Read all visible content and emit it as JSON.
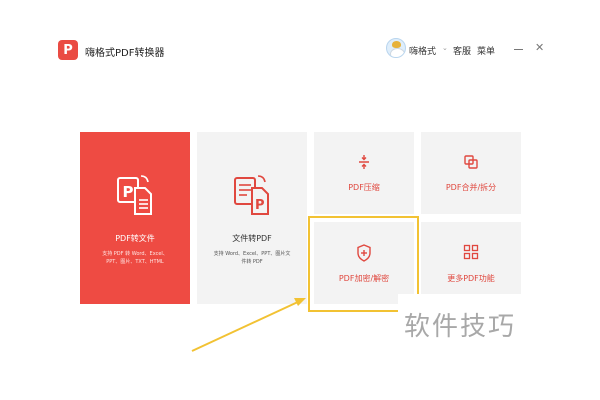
{
  "app": {
    "logo_letter": "P",
    "title": "嗨格式PDF转换器",
    "username": "嗨格式",
    "user_caret": "⌄",
    "service_label": "客服",
    "menu_label": "菜单",
    "close_glyph": "✕"
  },
  "cards": {
    "main": {
      "label": "PDF转文件",
      "desc_line1": "支持 PDF 转 Word、Excel、",
      "desc_line2": "PPT、图片、TXT、HTML"
    },
    "to_pdf": {
      "label": "文件转PDF",
      "desc_line1": "支持 Word、Excel、PPT、图片文",
      "desc_line2": "件转 PDF"
    },
    "compress": {
      "label": "PDF压缩"
    },
    "merge": {
      "label": "PDF合并/拆分"
    },
    "encrypt": {
      "label": "PDF加密/解密"
    },
    "more": {
      "label": "更多PDF功能"
    }
  },
  "watermark": "软件技巧",
  "colors": {
    "accent": "#ee4b43",
    "icon_red": "#e0483f",
    "highlight": "#f2c233",
    "card_bg": "#f3f3f3"
  },
  "icons": {
    "logo": "pdf-logo-icon",
    "minimize": "minimize-icon",
    "close": "close-icon",
    "compress": "compress-icon",
    "merge": "merge-icon",
    "encrypt": "shield-plus-icon",
    "more": "grid-icon"
  }
}
